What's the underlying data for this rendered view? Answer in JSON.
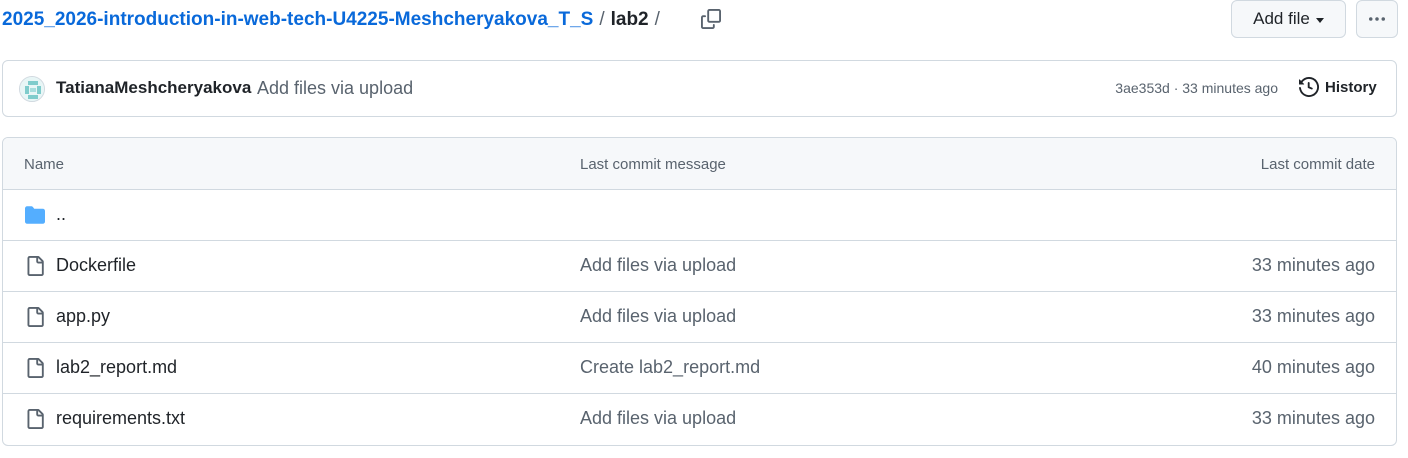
{
  "breadcrumb": {
    "repo": "2025_2026-introduction-in-web-tech-U4225-Meshcheryakova_T_S",
    "separator": "/",
    "current": "lab2",
    "trailing_separator": "/"
  },
  "toolbar": {
    "add_file_label": "Add file",
    "more_icon": "kebab-horizontal-icon",
    "copy_icon": "copy-icon"
  },
  "commit": {
    "author": "TatianaMeshcheryakova",
    "message": "Add files via upload",
    "sha": "3ae353d",
    "separator": "·",
    "time": "33 minutes ago",
    "history_label": "History",
    "history_icon": "history-icon"
  },
  "table": {
    "headers": {
      "name": "Name",
      "message": "Last commit message",
      "date": "Last commit date"
    },
    "parent": {
      "name": "..",
      "icon": "folder-icon"
    },
    "files": [
      {
        "name": "Dockerfile",
        "message": "Add files via upload",
        "date": "33 minutes ago",
        "icon": "file-icon"
      },
      {
        "name": "app.py",
        "message": "Add files via upload",
        "date": "33 minutes ago",
        "icon": "file-icon"
      },
      {
        "name": "lab2_report.md",
        "message": "Create lab2_report.md",
        "date": "40 minutes ago",
        "icon": "file-icon"
      },
      {
        "name": "requirements.txt",
        "message": "Add files via upload",
        "date": "33 minutes ago",
        "icon": "file-icon"
      }
    ]
  },
  "colors": {
    "link": "#0969da",
    "text": "#1f2328",
    "muted": "#59636e",
    "border": "#d1d9e0",
    "header_bg": "#f6f8fa",
    "folder": "#54aeff"
  }
}
